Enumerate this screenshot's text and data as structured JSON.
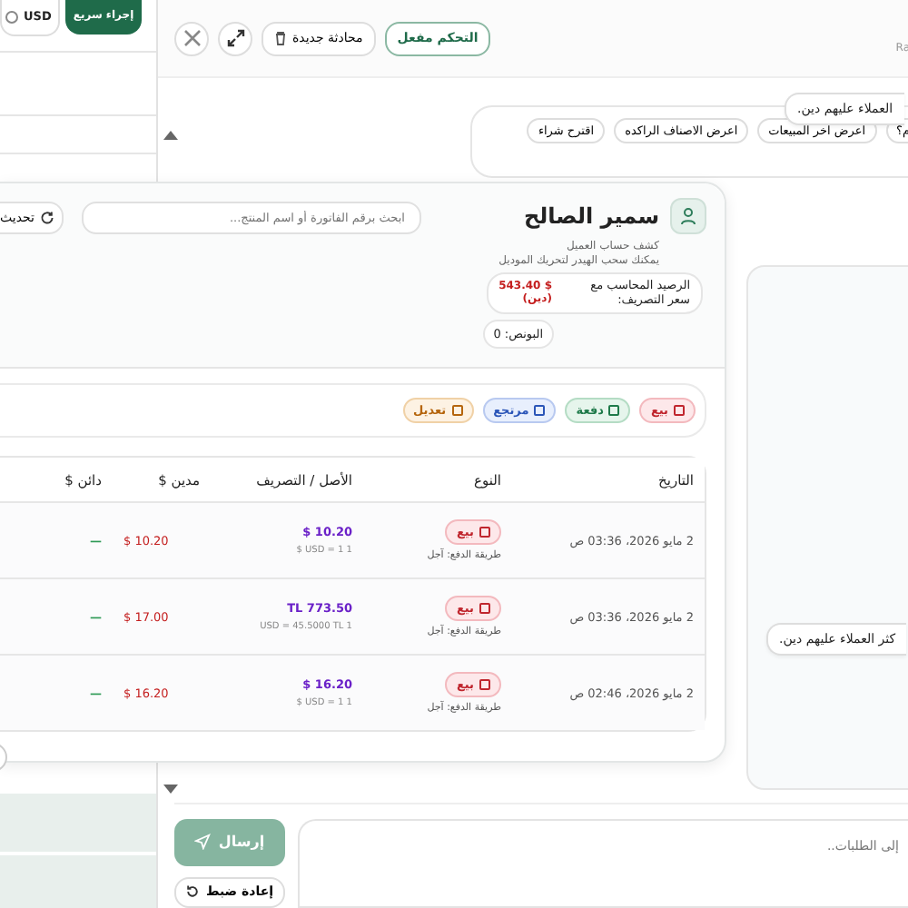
{
  "background_app": {
    "currency": "USD",
    "quick_action": "إجراء سريع"
  },
  "assistant": {
    "control": {
      "label": "التحكم مفعل",
      "on": true
    },
    "new_chat": "محادثة جديدة",
    "model_label": "Ra",
    "user_message": "العملاء عليهم دين.",
    "suggestions": [
      "م؟",
      "اعرض اخر المبيعات",
      "اعرض الاصناف الراكده",
      "اقترح شراء"
    ],
    "side_message": "كثر العملاء عليهم دين.",
    "composer": {
      "placeholder": "إلى الطلبات..",
      "send": "إرسال",
      "reset": "إعادة ضبط"
    }
  },
  "statement": {
    "customer": "سمير الصالح",
    "subtitle": "كشف حساب العميل",
    "hint": "يمكنك سحب الهيدر لتحريك الموديل",
    "balance_label": "الرصيد المحاسب مع سعر التصريف:",
    "balance_value": "$ 543.40",
    "balance_note": "(دين)",
    "bonus": "البونص: 0",
    "search": {
      "placeholder": "ابحث برقم الفاتورة أو اسم المنتج..."
    },
    "refresh": "تحديث",
    "filters": [
      {
        "kind": "sale",
        "label": "بيع"
      },
      {
        "kind": "payment",
        "label": "دفعة"
      },
      {
        "kind": "return",
        "label": "مرتجع"
      },
      {
        "kind": "adjustment",
        "label": "تعديل"
      }
    ],
    "table": {
      "columns": [
        "التاريخ",
        "النوع",
        "الأصل / التصريف",
        "مدين $",
        "دائن $"
      ],
      "rows": [
        {
          "date": "2 مايو 2026، 03:36 ص",
          "type": {
            "kind": "sale",
            "label": "بيع"
          },
          "payment": "طريقة الدفع: آجل",
          "original": "$ 10.20",
          "rate": "$ USD = 1 1",
          "debit": "$ 10.20",
          "credit": "—"
        },
        {
          "date": "2 مايو 2026، 03:36 ص",
          "type": {
            "kind": "sale",
            "label": "بيع"
          },
          "payment": "طريقة الدفع: آجل",
          "original": "TL 773.50",
          "rate": "USD = 45.5000 TL 1",
          "debit": "$ 17.00",
          "credit": "—"
        },
        {
          "date": "2 مايو 2026، 02:46 ص",
          "type": {
            "kind": "sale",
            "label": "بيع"
          },
          "payment": "طريقة الدفع: آجل",
          "original": "$ 16.20",
          "rate": "$ USD = 1 1",
          "debit": "$ 16.20",
          "credit": "—"
        }
      ]
    }
  }
}
